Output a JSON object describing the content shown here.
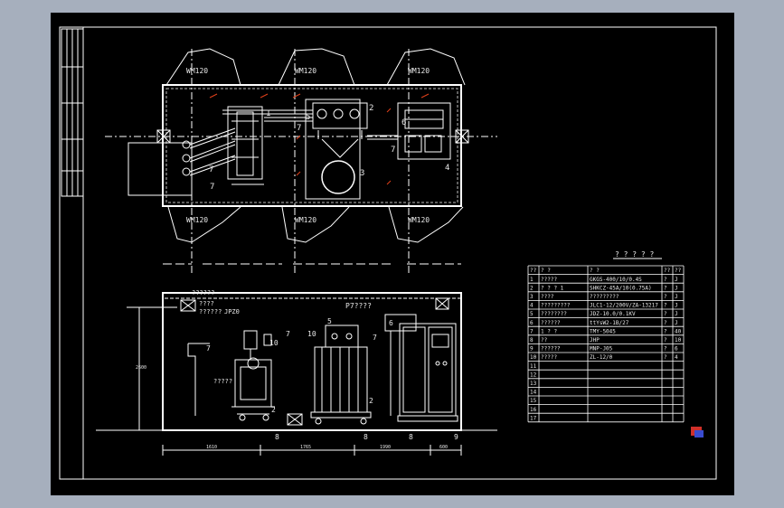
{
  "colors": {
    "background": "#a6afbd",
    "sheet": "#000000",
    "line": "#ffffff",
    "dim": "#d8d8d8",
    "accent": "#e0401a"
  },
  "plan_view": {
    "light_labels_top": [
      "WM120",
      "WM120",
      "WM120"
    ],
    "light_labels_bottom": [
      "WM120",
      "WM120",
      "WM120"
    ],
    "callouts": [
      "7",
      "7",
      "7",
      "7",
      "5",
      "3",
      "4",
      "1",
      "2",
      "6"
    ]
  },
  "elevation_view": {
    "notes": [
      "??????",
      "????",
      "??????",
      "JPZ0",
      "?????",
      "P7????"
    ],
    "dimension_labels": [
      "1610",
      "1765",
      "1990",
      "600"
    ],
    "callouts": [
      "7",
      "10",
      "7",
      "10",
      "5",
      "7",
      "8",
      "8",
      "8",
      "9",
      "6",
      "2",
      "2"
    ]
  },
  "table": {
    "title": "? ? ? ? ?",
    "header": [
      "??",
      "?      ?",
      "?      ?",
      "??",
      "??"
    ],
    "rows": [
      [
        "1",
        "?????",
        "GKGS-400/10/0.4S",
        "?",
        "J"
      ],
      [
        "2",
        "? ? ? 1",
        "SHKCZ-45A/10(0.75A)",
        "?",
        "J"
      ],
      [
        "3",
        "????",
        "?????????",
        "?",
        "J"
      ],
      [
        "4",
        "?????????",
        "JLC1-12/200V/ZA-13217",
        "?",
        "J"
      ],
      [
        "5",
        "????????",
        "JDZ-10.0/0.1KV",
        "?",
        "J"
      ],
      [
        "6",
        "??????",
        "ttYsW2-1B/27",
        "?",
        "J"
      ],
      [
        "7",
        "1 ? ?",
        "TMY-5045",
        "?",
        "40"
      ],
      [
        "8",
        "??",
        "JHP",
        "?",
        "10"
      ],
      [
        "9",
        "??????",
        "MNP-J05",
        "?",
        "6"
      ],
      [
        "10",
        "?????",
        "ZL-12/0",
        "?",
        "4"
      ],
      [
        "11",
        "",
        "",
        "",
        ""
      ],
      [
        "12",
        "",
        "",
        "",
        ""
      ],
      [
        "13",
        "",
        "",
        "",
        ""
      ],
      [
        "14",
        "",
        "",
        "",
        ""
      ],
      [
        "15",
        "",
        "",
        "",
        ""
      ],
      [
        "16",
        "",
        "",
        "",
        ""
      ],
      [
        "17",
        "",
        "",
        "",
        ""
      ]
    ]
  }
}
